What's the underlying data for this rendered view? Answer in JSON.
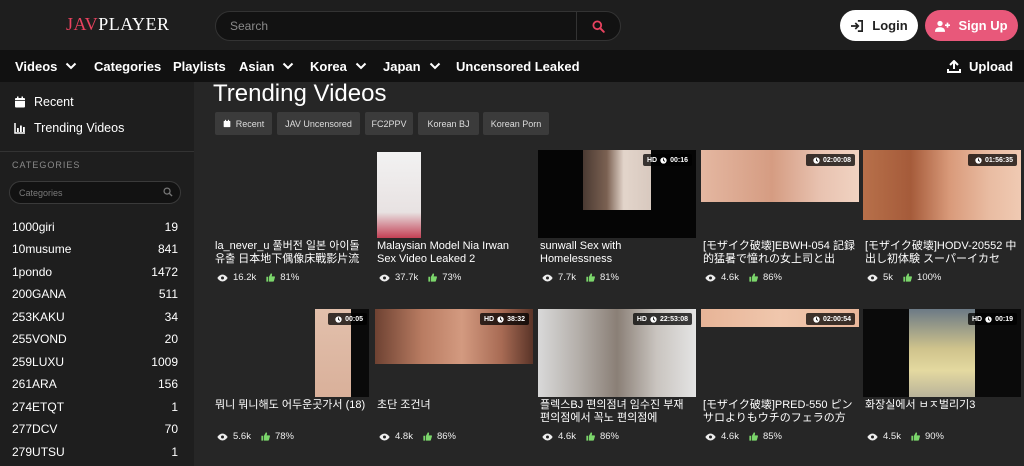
{
  "header": {
    "logo_part1": "JAV",
    "logo_part2": "PLAYER",
    "search_placeholder": "Search",
    "login_label": "Login",
    "signup_label": "Sign Up"
  },
  "nav": {
    "items": [
      {
        "label": "Videos",
        "dropdown": true
      },
      {
        "label": "Categories",
        "dropdown": false
      },
      {
        "label": "Playlists",
        "dropdown": false
      },
      {
        "label": "Asian",
        "dropdown": true
      },
      {
        "label": "Korea",
        "dropdown": true
      },
      {
        "label": "Japan",
        "dropdown": true
      },
      {
        "label": "Uncensored Leaked",
        "dropdown": false
      }
    ],
    "upload_label": "Upload"
  },
  "sidebar": {
    "links": [
      {
        "label": "Recent",
        "icon": "calendar-icon"
      },
      {
        "label": "Trending Videos",
        "icon": "chart-icon"
      }
    ],
    "categories_heading": "CATEGORIES",
    "categories_placeholder": "Categories",
    "categories": [
      {
        "name": "1000giri",
        "count": "19"
      },
      {
        "name": "10musume",
        "count": "841"
      },
      {
        "name": "1pondo",
        "count": "1472"
      },
      {
        "name": "200GANA",
        "count": "511"
      },
      {
        "name": "253KAKU",
        "count": "34"
      },
      {
        "name": "255VOND",
        "count": "20"
      },
      {
        "name": "259LUXU",
        "count": "1009"
      },
      {
        "name": "261ARA",
        "count": "156"
      },
      {
        "name": "274ETQT",
        "count": "1"
      },
      {
        "name": "277DCV",
        "count": "70"
      },
      {
        "name": "279UTSU",
        "count": "1"
      }
    ]
  },
  "main": {
    "title": "Trending Videos",
    "chips": [
      {
        "label": "Recent",
        "icon": "calendar-icon"
      },
      {
        "label": "JAV Uncensored"
      },
      {
        "label": "FC2PPV"
      },
      {
        "label": "Korean BJ"
      },
      {
        "label": "Korean Porn"
      }
    ],
    "videos": [
      {
        "title": "la_never_u 풀버전 일본 아이돌 유출 日本地下偶像床戰影片流",
        "views": "16.2k",
        "likes": "81%",
        "hd": "",
        "duration": ""
      },
      {
        "title": "Malaysian Model Nia Irwan Sex Video Leaked 2",
        "views": "37.7k",
        "likes": "73%",
        "hd": "",
        "duration": ""
      },
      {
        "title": "sunwall Sex with Homelessness",
        "views": "7.7k",
        "likes": "81%",
        "hd": "HD",
        "duration": "00:16"
      },
      {
        "title": "[モザイク破壊]EBWH-054 記録的猛暑で憧れの女上司と出",
        "views": "4.6k",
        "likes": "86%",
        "hd": "",
        "duration": "02:00:08"
      },
      {
        "title": "[モザイク破壊]HODV-20552 中出し初体験 スーパーイカセ",
        "views": "5k",
        "likes": "100%",
        "hd": "",
        "duration": "01:56:35"
      },
      {
        "title": "뭐니 뭐니해도 어두운곳가서 (18)",
        "views": "5.6k",
        "likes": "78%",
        "hd": "",
        "duration": "00:05"
      },
      {
        "title": "초단 조건녀",
        "views": "4.8k",
        "likes": "86%",
        "hd": "HD",
        "duration": "38:32"
      },
      {
        "title": "플렉스BJ 편의점녀 임수진 부재 편의점에서 꼭노 편의점에",
        "views": "4.6k",
        "likes": "86%",
        "hd": "HD",
        "duration": "22:53:08"
      },
      {
        "title": "[モザイク破壊]PRED-550 ピンサロよりもウチのフェラの方",
        "views": "4.6k",
        "likes": "85%",
        "hd": "",
        "duration": "02:00:54"
      },
      {
        "title": "화장실에서 ㅂㅈ벌리기3",
        "views": "4.5k",
        "likes": "90%",
        "hd": "HD",
        "duration": "00:19"
      }
    ]
  },
  "colors": {
    "accent": "#e8425f",
    "signup": "#e8587a",
    "like": "#7bd66b",
    "background": "#262626"
  }
}
